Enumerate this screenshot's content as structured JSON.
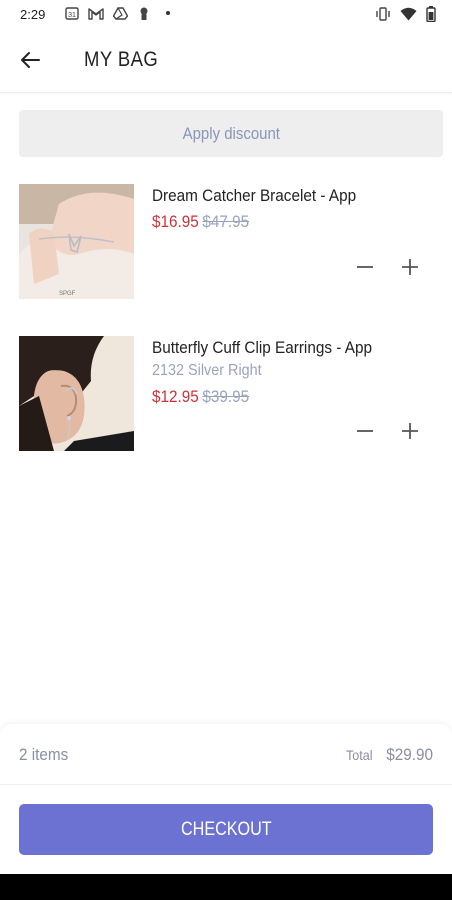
{
  "status_bar": {
    "time": "2:29",
    "left_icons": [
      "calendar-icon",
      "gmail-icon",
      "drive-icon",
      "keyhole-icon",
      "notification-dot-icon"
    ],
    "right_icons": [
      "vibrate-icon",
      "wifi-icon",
      "battery-icon"
    ]
  },
  "header": {
    "title": "MY BAG",
    "back_icon": "arrow-left-icon"
  },
  "discount": {
    "label": "Apply discount"
  },
  "items": [
    {
      "name": "Dream Catcher Bracelet - App",
      "variant": "",
      "price": "$16.95",
      "original_price": "$47.95",
      "image": "bracelet-on-wrist-photo"
    },
    {
      "name": "Butterfly Cuff Clip Earrings - App",
      "variant": "2132 Silver Right",
      "price": "$12.95",
      "original_price": "$39.95",
      "image": "ear-cuff-photo"
    }
  ],
  "summary": {
    "count": "2 items",
    "total_label": "Total",
    "total": "$29.90"
  },
  "checkout": {
    "label": "CHECKOUT"
  },
  "colors": {
    "accent": "#6c72d2",
    "sale_price": "#d0303a",
    "muted": "#9aa3bd",
    "discount_bg": "#eeeeef"
  }
}
